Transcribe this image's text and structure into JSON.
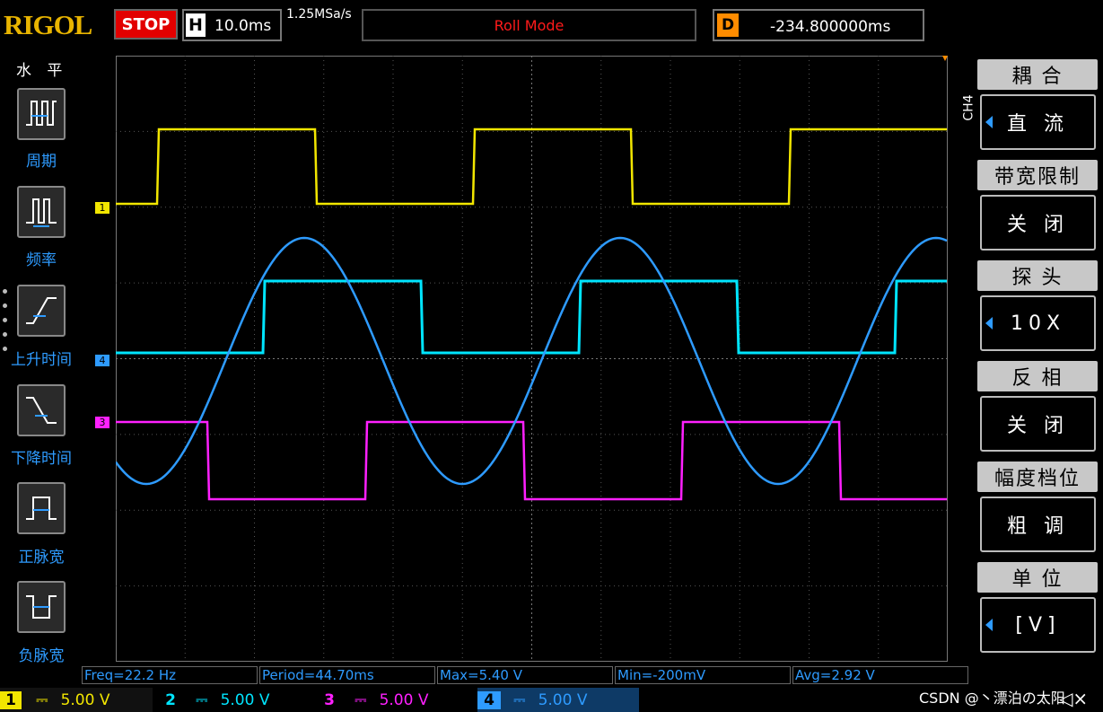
{
  "brand": "RIGOL",
  "run_state": "STOP",
  "horizontal": {
    "label": "H",
    "timebase": "10.0ms"
  },
  "sample_rate": "1.25MSa/s",
  "mode": "Roll Mode",
  "delay": {
    "label": "D",
    "value": "-234.800000ms"
  },
  "left_menu": {
    "title": "水 平",
    "items": [
      {
        "label": "周期",
        "icon": "period-icon"
      },
      {
        "label": "频率",
        "icon": "frequency-icon"
      },
      {
        "label": "上升时间",
        "icon": "rise-time-icon"
      },
      {
        "label": "下降时间",
        "icon": "fall-time-icon"
      },
      {
        "label": "正脉宽",
        "icon": "positive-width-icon"
      },
      {
        "label": "负脉宽",
        "icon": "negative-width-icon"
      }
    ]
  },
  "right_menu": {
    "channel": "CH4",
    "items": [
      {
        "title": "耦 合",
        "value": "直 流",
        "arrow": true
      },
      {
        "title": "带宽限制",
        "value": "关 闭",
        "arrow": false
      },
      {
        "title": "探 头",
        "value": "10X",
        "arrow": true
      },
      {
        "title": "反 相",
        "value": "关 闭",
        "arrow": false
      },
      {
        "title": "幅度档位",
        "value": "粗 调",
        "arrow": false
      },
      {
        "title": "单 位",
        "value": "[V]",
        "arrow": true
      }
    ]
  },
  "channel_markers": {
    "ch1": "1",
    "ch4": "4",
    "ch3": "3"
  },
  "measurements": {
    "freq": "Freq=22.2 Hz",
    "period": "Period=44.70ms",
    "max": "Max=5.40 V",
    "min": "Min=-200mV",
    "avg": "Avg=2.92 V"
  },
  "channels": [
    {
      "num": "1",
      "scale": "5.00 V",
      "color": "#f2e600"
    },
    {
      "num": "2",
      "scale": "5.00 V",
      "color": "#00e5ff"
    },
    {
      "num": "3",
      "scale": "5.00 V",
      "color": "#ff20ff"
    },
    {
      "num": "4",
      "scale": "5.00 V",
      "color": "#2e9bff"
    }
  ],
  "watermark": "CSDN @丶漂泊の太阳",
  "colors": {
    "ch1": "#f2e600",
    "ch2": "#00e5ff",
    "ch3": "#ff20ff",
    "ch4": "#2e9bff"
  }
}
